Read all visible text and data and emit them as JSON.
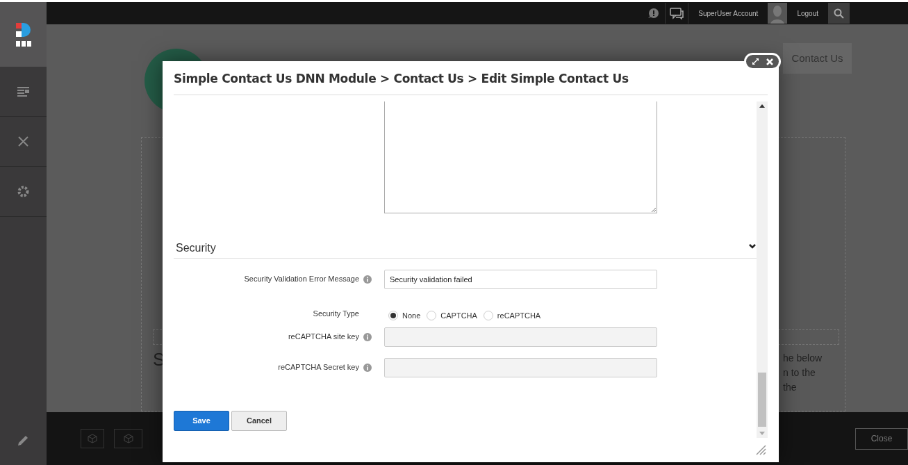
{
  "top_bar": {
    "account": "SuperUser Account",
    "logout": "Logout"
  },
  "background": {
    "nav_item": "Contact Us",
    "fragment_1": "S",
    "fragment_lines": [
      "he below",
      "n to the",
      "the"
    ],
    "close_button": "Close"
  },
  "dialog": {
    "title": "Simple Contact Us DNN Module > Contact Us > Edit Simple Contact Us",
    "section": {
      "title": "Security",
      "expanded": true
    },
    "fields": [
      {
        "kind": "text",
        "label": "Security Validation Error Message",
        "info": true,
        "value": "Security validation failed",
        "disabled": false
      },
      {
        "kind": "radio",
        "label": "Security Type",
        "info": false,
        "options": [
          {
            "label": "None",
            "selected": true
          },
          {
            "label": "CAPTCHA",
            "selected": false
          },
          {
            "label": "reCAPTCHA",
            "selected": false
          }
        ]
      },
      {
        "kind": "text",
        "label": "reCAPTCHA site key",
        "info": true,
        "disabled": true
      },
      {
        "kind": "text",
        "label": "reCAPTCHA Secret key",
        "info": true,
        "disabled": true
      }
    ],
    "buttons": [
      {
        "label": "Save",
        "kind": "primary"
      },
      {
        "label": "Cancel",
        "kind": "secondary"
      }
    ]
  }
}
